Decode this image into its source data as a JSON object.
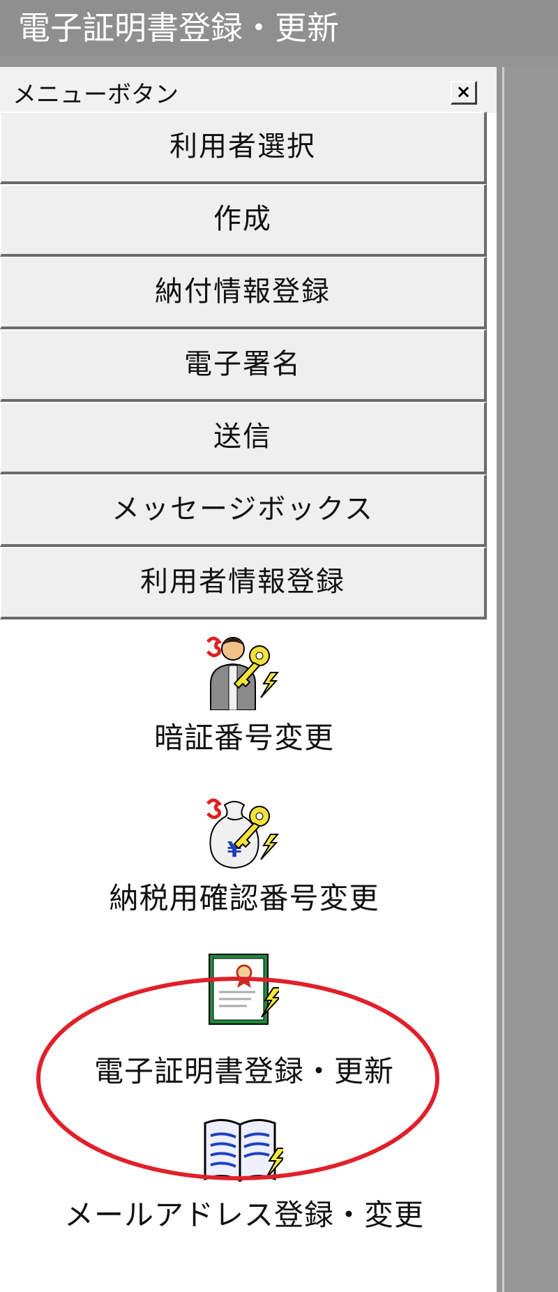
{
  "window": {
    "title": "電子証明書登録・更新"
  },
  "panel": {
    "header_label": "メニューボタン",
    "close_glyph": "×"
  },
  "menu": {
    "buttons": [
      "利用者選択",
      "作成",
      "納付情報登録",
      "電子署名",
      "送信",
      "メッセージボックス",
      "利用者情報登録"
    ]
  },
  "icon_items": [
    {
      "label": "暗証番号変更",
      "icon": "person-key-icon"
    },
    {
      "label": "納税用確認番号変更",
      "icon": "money-bag-key-icon"
    },
    {
      "label": "電子証明書登録・更新",
      "icon": "certificate-icon"
    },
    {
      "label": "メールアドレス登録・変更",
      "icon": "address-book-icon"
    }
  ],
  "colors": {
    "highlight_ellipse": "#e0202a",
    "panel_bg": "#ffffff",
    "button_bg": "#efefef",
    "title_bar_bg": "#8f8f8f"
  }
}
